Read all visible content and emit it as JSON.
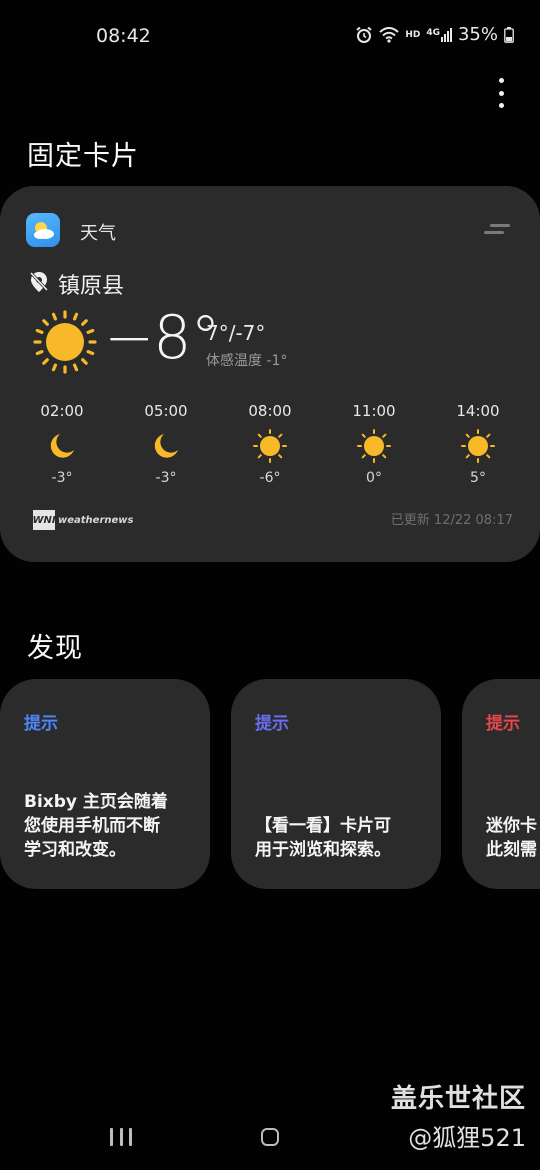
{
  "status_bar": {
    "time": "08:42",
    "hd": "HD",
    "network": "4G",
    "battery": "35%"
  },
  "sections": {
    "pinned_title": "固定卡片",
    "discover_title": "发现"
  },
  "weather": {
    "app_name": "天气",
    "location": "镇原县",
    "current_temp": "−8°",
    "hi_lo": "7°/-7°",
    "feels_like": "体感温度 -1°",
    "hourly": [
      {
        "time": "02:00",
        "icon": "moon-icon",
        "temp": "-3°"
      },
      {
        "time": "05:00",
        "icon": "moon-icon",
        "temp": "-3°"
      },
      {
        "time": "08:00",
        "icon": "sun-icon",
        "temp": "-6°"
      },
      {
        "time": "11:00",
        "icon": "sun-icon",
        "temp": "0°"
      },
      {
        "time": "14:00",
        "icon": "sun-icon",
        "temp": "5°"
      }
    ],
    "provider_logo": "WNI",
    "provider_text": "weathernews",
    "updated": "已更新 12/22 08:17"
  },
  "tips": [
    {
      "label": "提示",
      "color": "#4f86f7",
      "text": "Bixby 主页会随着\n您使用手机而不断\n学习和改变。"
    },
    {
      "label": "提示",
      "color": "#6b6df0",
      "text": "【看一看】卡片可\n用于浏览和探索。"
    },
    {
      "label": "提示",
      "color": "#e5484d",
      "text": "迷你卡\n此刻需"
    }
  ],
  "watermark": {
    "line1": "盖乐世社区",
    "line2": "@狐狸521"
  },
  "colors": {
    "background": "#020202",
    "card": "#2b2b2b",
    "sun": "#f7b928",
    "moon": "#f7b928"
  }
}
